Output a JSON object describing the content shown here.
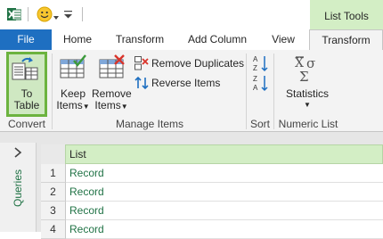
{
  "title_bar": {
    "contextual_tab": "List Tools"
  },
  "tabs": [
    {
      "label": "File"
    },
    {
      "label": "Home"
    },
    {
      "label": "Transform"
    },
    {
      "label": "Add Column"
    },
    {
      "label": "View"
    },
    {
      "label": "Transform"
    }
  ],
  "ribbon": {
    "convert": {
      "to_table_line1": "To",
      "to_table_line2": "Table",
      "group": "Convert"
    },
    "manage": {
      "keep_line1": "Keep",
      "keep_line2": "Items",
      "remove_line1": "Remove",
      "remove_line2": "Items",
      "remove_duplicates": "Remove Duplicates",
      "reverse_items": "Reverse Items",
      "group": "Manage Items"
    },
    "sort": {
      "group": "Sort"
    },
    "numeric": {
      "statistics": "Statistics",
      "group": "Numeric List"
    }
  },
  "queries_pane": {
    "label": "Queries"
  },
  "grid": {
    "column_header": "List",
    "rows": [
      {
        "num": "1",
        "value": "Record"
      },
      {
        "num": "2",
        "value": "Record"
      },
      {
        "num": "3",
        "value": "Record"
      },
      {
        "num": "4",
        "value": "Record"
      }
    ]
  },
  "colors": {
    "accent": "#6cb33f",
    "file_tab": "#1e6fc1",
    "contextual": "#d3eec5",
    "record_text": "#217346"
  }
}
